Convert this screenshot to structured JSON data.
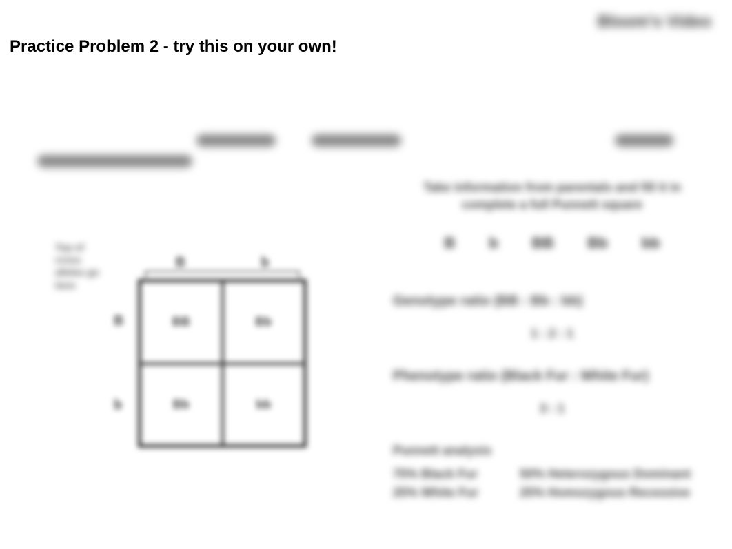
{
  "topRight": "Bloom's Video",
  "title": "Practice Problem 2 - try this on your own!",
  "punnett": {
    "labelText1": "Top of",
    "labelText2": "cross",
    "labelText3": "alleles go",
    "labelText4": "here",
    "topHeaders": [
      "B",
      "b"
    ],
    "leftHeaders": [
      "B",
      "b"
    ],
    "cells": [
      "BB",
      "Bb",
      "Bb",
      "bb"
    ]
  },
  "instruction": "Take information from parentals and fill it in complete a full Punnett square",
  "symbols": [
    "B",
    "b",
    "BB",
    "Bb",
    "bb"
  ],
  "genotype": {
    "label": "Genotype ratio (BB : Bb : bb)",
    "value": "1 : 2 : 1"
  },
  "phenotype": {
    "label": "Phenotype ratio (Black Fur : White Fur)",
    "value": "3 : 1"
  },
  "summary": {
    "title": "Punnett analysis",
    "col1Line1": "75% Black Fur",
    "col1Line2": "25% White Fur",
    "col2Line1": "50% Heterozygous Dominant",
    "col2Line2": "25% Homozygous Recessive"
  }
}
